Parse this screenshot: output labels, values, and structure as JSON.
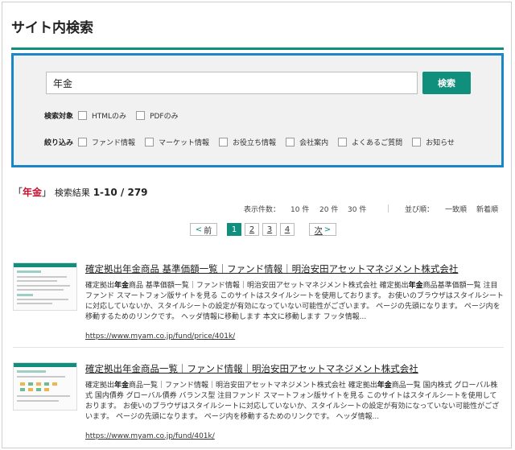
{
  "page": {
    "title": "サイト内検索"
  },
  "search": {
    "query": "年金",
    "button_label": "検索",
    "target_label": "検索対象",
    "targets": [
      "HTMLのみ",
      "PDFのみ"
    ],
    "filter_label": "絞り込み",
    "filters": [
      "ファンド情報",
      "マーケット情報",
      "お役立ち情報",
      "会社案内",
      "よくあるご質問",
      "お知らせ"
    ]
  },
  "results_header": {
    "open_bracket": "「",
    "query": "年金",
    "close_bracket": "」",
    "label": "検索結果",
    "range": "1-10 / 279"
  },
  "display": {
    "count_label": "表示件数：",
    "counts": [
      "10 件",
      "20 件",
      "30 件"
    ],
    "sort_label": "並び順：",
    "sort_options": [
      "一致順",
      "新着順"
    ]
  },
  "pager": {
    "prev": "前",
    "pages": [
      "1",
      "2",
      "3",
      "4"
    ],
    "next": "次"
  },
  "results": [
    {
      "title": "確定拠出年金商品 基準価額一覧｜ファンド情報｜明治安田アセットマネジメント株式会社",
      "snippet": [
        "確定拠出",
        "年金",
        "商品 基準価額一覧｜ファンド情報｜明治安田アセットマネジメント株式会社 確定拠出",
        "年金",
        "商品基準価額一覧 注目ファンド スマートフォン版サイトを見る このサイトはスタイルシートを使用しております。 お使いのブラウザはスタイルシートに対応していないか、スタイルシートの設定が有効になっていない可能性がございます。 ページの先頭になります。 ページ内を移動するためのリンクです。 ヘッダ情報に移動します 本文に移動します フッタ情報..."
      ],
      "url": "https://www.myam.co.jp/fund/price/401k/"
    },
    {
      "title": "確定拠出年金商品一覧｜ファンド情報｜明治安田アセットマネジメント株式会社",
      "snippet": [
        "確定拠出",
        "年金",
        "商品一覧｜ファンド情報｜明治安田アセットマネジメント株式会社 確定拠出",
        "年金",
        "商品一覧 国内株式 グローバル株式 国内債券 グローバル債券 バランス型 注目ファンド スマートフォン版サイトを見る このサイトはスタイルシートを使用しております。 お使いのブラウザはスタイルシートに対応していないか、スタイルシートの設定が有効になっていない可能性がございます。 ページの先頭になります。 ページ内を移動するためのリンクです。 ヘッダ情報..."
      ],
      "url": "https://www.myam.co.jp/fund/401k/"
    }
  ],
  "colors": {
    "accent": "#0f8f7c",
    "panel_border": "#1a86c8",
    "highlight": "#c8102e"
  }
}
